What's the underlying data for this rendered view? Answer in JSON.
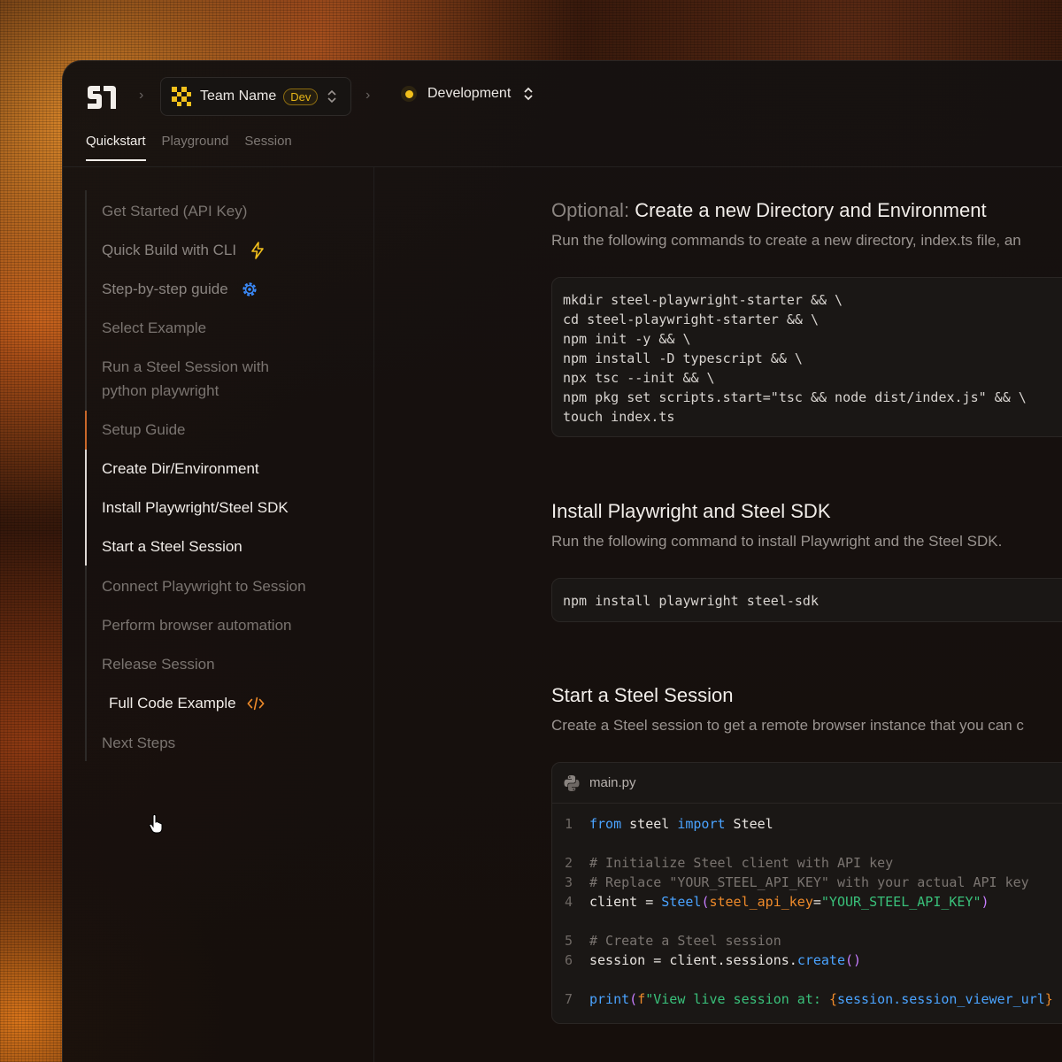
{
  "header": {
    "team_name": "Team Name",
    "team_badge": "Dev",
    "environment": "Development"
  },
  "tabs": [
    {
      "label": "Quickstart",
      "active": true
    },
    {
      "label": "Playground",
      "active": false
    },
    {
      "label": "Session",
      "active": false
    }
  ],
  "sidebar": {
    "items": [
      {
        "label": "Get Started (API Key)"
      },
      {
        "label": "Quick Build with CLI",
        "icon": "lightning-icon"
      },
      {
        "label": "Step-by-step guide",
        "icon": "gear-icon"
      },
      {
        "label": "Select Example"
      },
      {
        "label": "Run a Steel Session with",
        "label2": "python playwright"
      },
      {
        "label": "Setup Guide"
      },
      {
        "label": "Create Dir/Environment"
      },
      {
        "label": "Install Playwright/Steel SDK"
      },
      {
        "label": "Start a Steel Session"
      },
      {
        "label": "Connect Playwright to Session"
      },
      {
        "label": "Perform browser automation"
      },
      {
        "label": "Release Session"
      },
      {
        "label": "Full Code Example",
        "icon": "code-icon"
      },
      {
        "label": "Next Steps"
      }
    ]
  },
  "sections": {
    "create_dir": {
      "prefix": "Optional:",
      "title": "Create a new Directory and Environment",
      "desc": "Run the following commands to create a new directory, index.ts file, an",
      "code": "mkdir steel-playwright-starter && \\\ncd steel-playwright-starter && \\\nnpm init -y && \\\nnpm install -D typescript && \\\nnpx tsc --init && \\\nnpm pkg set scripts.start=\"tsc && node dist/index.js\" && \\\ntouch index.ts"
    },
    "install": {
      "title": "Install Playwright and Steel SDK",
      "desc": "Run the following command to install Playwright and the Steel SDK.",
      "code": "npm install playwright steel-sdk"
    },
    "start": {
      "title": "Start a Steel Session",
      "desc": "Create a Steel session to get a remote browser instance that you can c",
      "file_name": "main.py",
      "line_numbers": [
        "1",
        "2",
        "3",
        "4",
        "5",
        "6",
        "7"
      ],
      "tokens": {
        "from": "from",
        "steel": " steel ",
        "import": "import",
        "Steel": " Steel",
        "comment1": "# Initialize Steel client with API key",
        "comment2": "# Replace \"YOUR_STEEL_API_KEY\" with your actual API key",
        "client": "client ",
        "eq": "= ",
        "SteelFn": "Steel",
        "paren_open": "(",
        "kwarg": "steel_api_key",
        "eq2": "=",
        "apikey": "\"YOUR_STEEL_API_KEY\"",
        "paren_close": ")",
        "comment3": "# Create a Steel session",
        "session": "session ",
        "eq3": "= ",
        "clientdot": "client.sessions.",
        "create": "create",
        "parens": "()",
        "print": "print",
        "pp": "(",
        "fstr": "f",
        "view": "\"View live session at: ",
        "brace_open": "{",
        "expr": "session.session_viewer_url",
        "brace_close": "}"
      }
    }
  },
  "colors": {
    "accent_orange": "#c9682a",
    "badge_yellow": "#e5b418",
    "keyword_blue": "#4aa3ff",
    "string_green": "#39c07a",
    "param_orange": "#ee8a2a"
  }
}
